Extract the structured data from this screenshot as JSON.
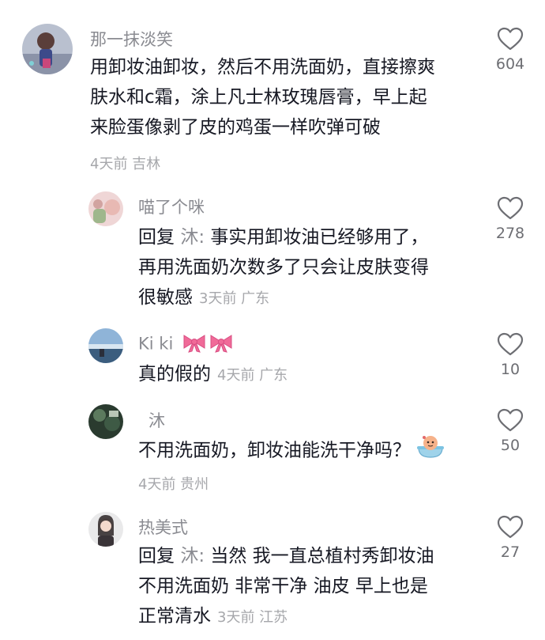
{
  "comments": [
    {
      "username": "那一抹淡笑",
      "text_lines": [
        "用卸妆油卸妆，然后不用洗面奶，直接擦爽",
        "肤水和c霜，涂上凡士林玫瑰唇膏，早上起",
        "来脸蛋像剥了皮的鸡蛋一样吹弹可破"
      ],
      "meta": "4天前 吉林",
      "likes": "604"
    },
    {
      "username": "喵了个咪",
      "reply_prefix": "回复",
      "reply_to": "沐:",
      "text_lines": [
        "事实用卸妆油已经够用了，",
        "再用洗面奶次数多了只会让皮肤变得",
        "很敏感"
      ],
      "meta": "3天前 广东",
      "likes": "278"
    },
    {
      "username": "Ki ki",
      "username_emoji": "🎀🎀",
      "text_lines": [
        "真的假的"
      ],
      "meta": "4天前 广东",
      "likes": "10"
    },
    {
      "username": "沐",
      "text_lines": [
        "不用洗面奶，卸妆油能洗干净吗？"
      ],
      "text_emoji": "bathing-face-emoji",
      "meta": "4天前 贵州",
      "likes": "50"
    },
    {
      "username": "热美式",
      "reply_prefix": "回复",
      "reply_to": "沐:",
      "text_lines": [
        "当然 我一直总植村秀卸妆油",
        "不用洗面奶 非常干净 油皮 早上也是",
        "正常清水"
      ],
      "meta": "3天前 江苏",
      "likes": "27"
    }
  ],
  "icons": {
    "like": "heart-outline-icon"
  },
  "colors": {
    "username": "#8a8b91",
    "text": "#161823",
    "meta": "#a6a7ab",
    "like_count": "#6d6e73",
    "bow": "#f06a98"
  }
}
